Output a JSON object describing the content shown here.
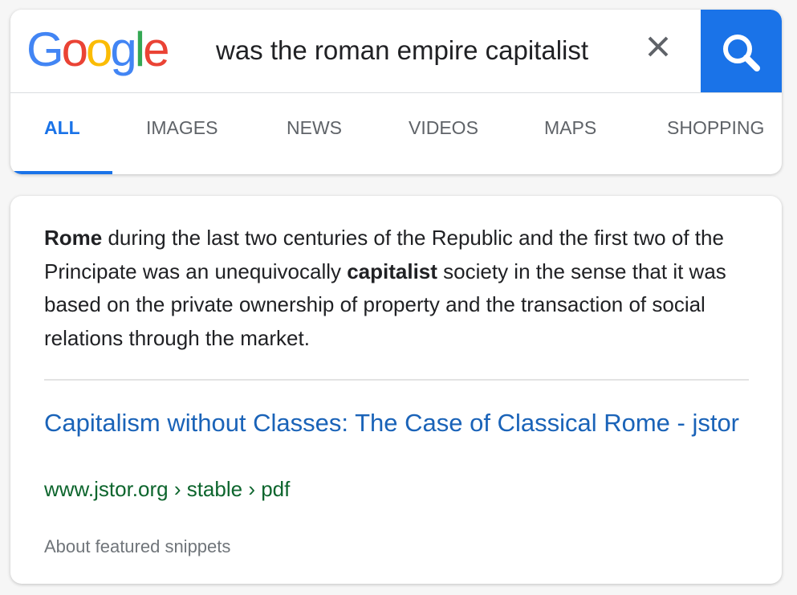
{
  "header": {
    "logo_letters": [
      {
        "char": "G",
        "color": "#4285F4"
      },
      {
        "char": "o",
        "color": "#EA4335"
      },
      {
        "char": "o",
        "color": "#FBBC05"
      },
      {
        "char": "g",
        "color": "#4285F4"
      },
      {
        "char": "l",
        "color": "#34A853"
      },
      {
        "char": "e",
        "color": "#EA4335"
      }
    ],
    "query": "was the roman empire capitalist",
    "clear_icon": "close-icon",
    "search_icon": "search-icon",
    "search_button_color": "#1a73e8"
  },
  "tabs": [
    {
      "label": "ALL",
      "active": true
    },
    {
      "label": "IMAGES",
      "active": false
    },
    {
      "label": "NEWS",
      "active": false
    },
    {
      "label": "VIDEOS",
      "active": false
    },
    {
      "label": "MAPS",
      "active": false
    },
    {
      "label": "SHOPPING",
      "active": false
    }
  ],
  "featured_snippet": {
    "text_parts": [
      {
        "text": "Rome",
        "bold": true
      },
      {
        "text": " during the last two centuries of the Republic and the first two of the Principate was an unequivocally ",
        "bold": false
      },
      {
        "text": "capitalist",
        "bold": true
      },
      {
        "text": " society in the sense that it was based on the private ownership of property and the transaction of social relations through the market.",
        "bold": false
      }
    ],
    "result_title": "Capitalism without Classes: The Case of Classical Rome - jstor",
    "result_url": "www.jstor.org › stable › pdf",
    "about_link": "About featured snippets"
  },
  "colors": {
    "link_blue": "#1a63b8",
    "url_green": "#0d652d",
    "active_tab": "#1a73e8"
  }
}
